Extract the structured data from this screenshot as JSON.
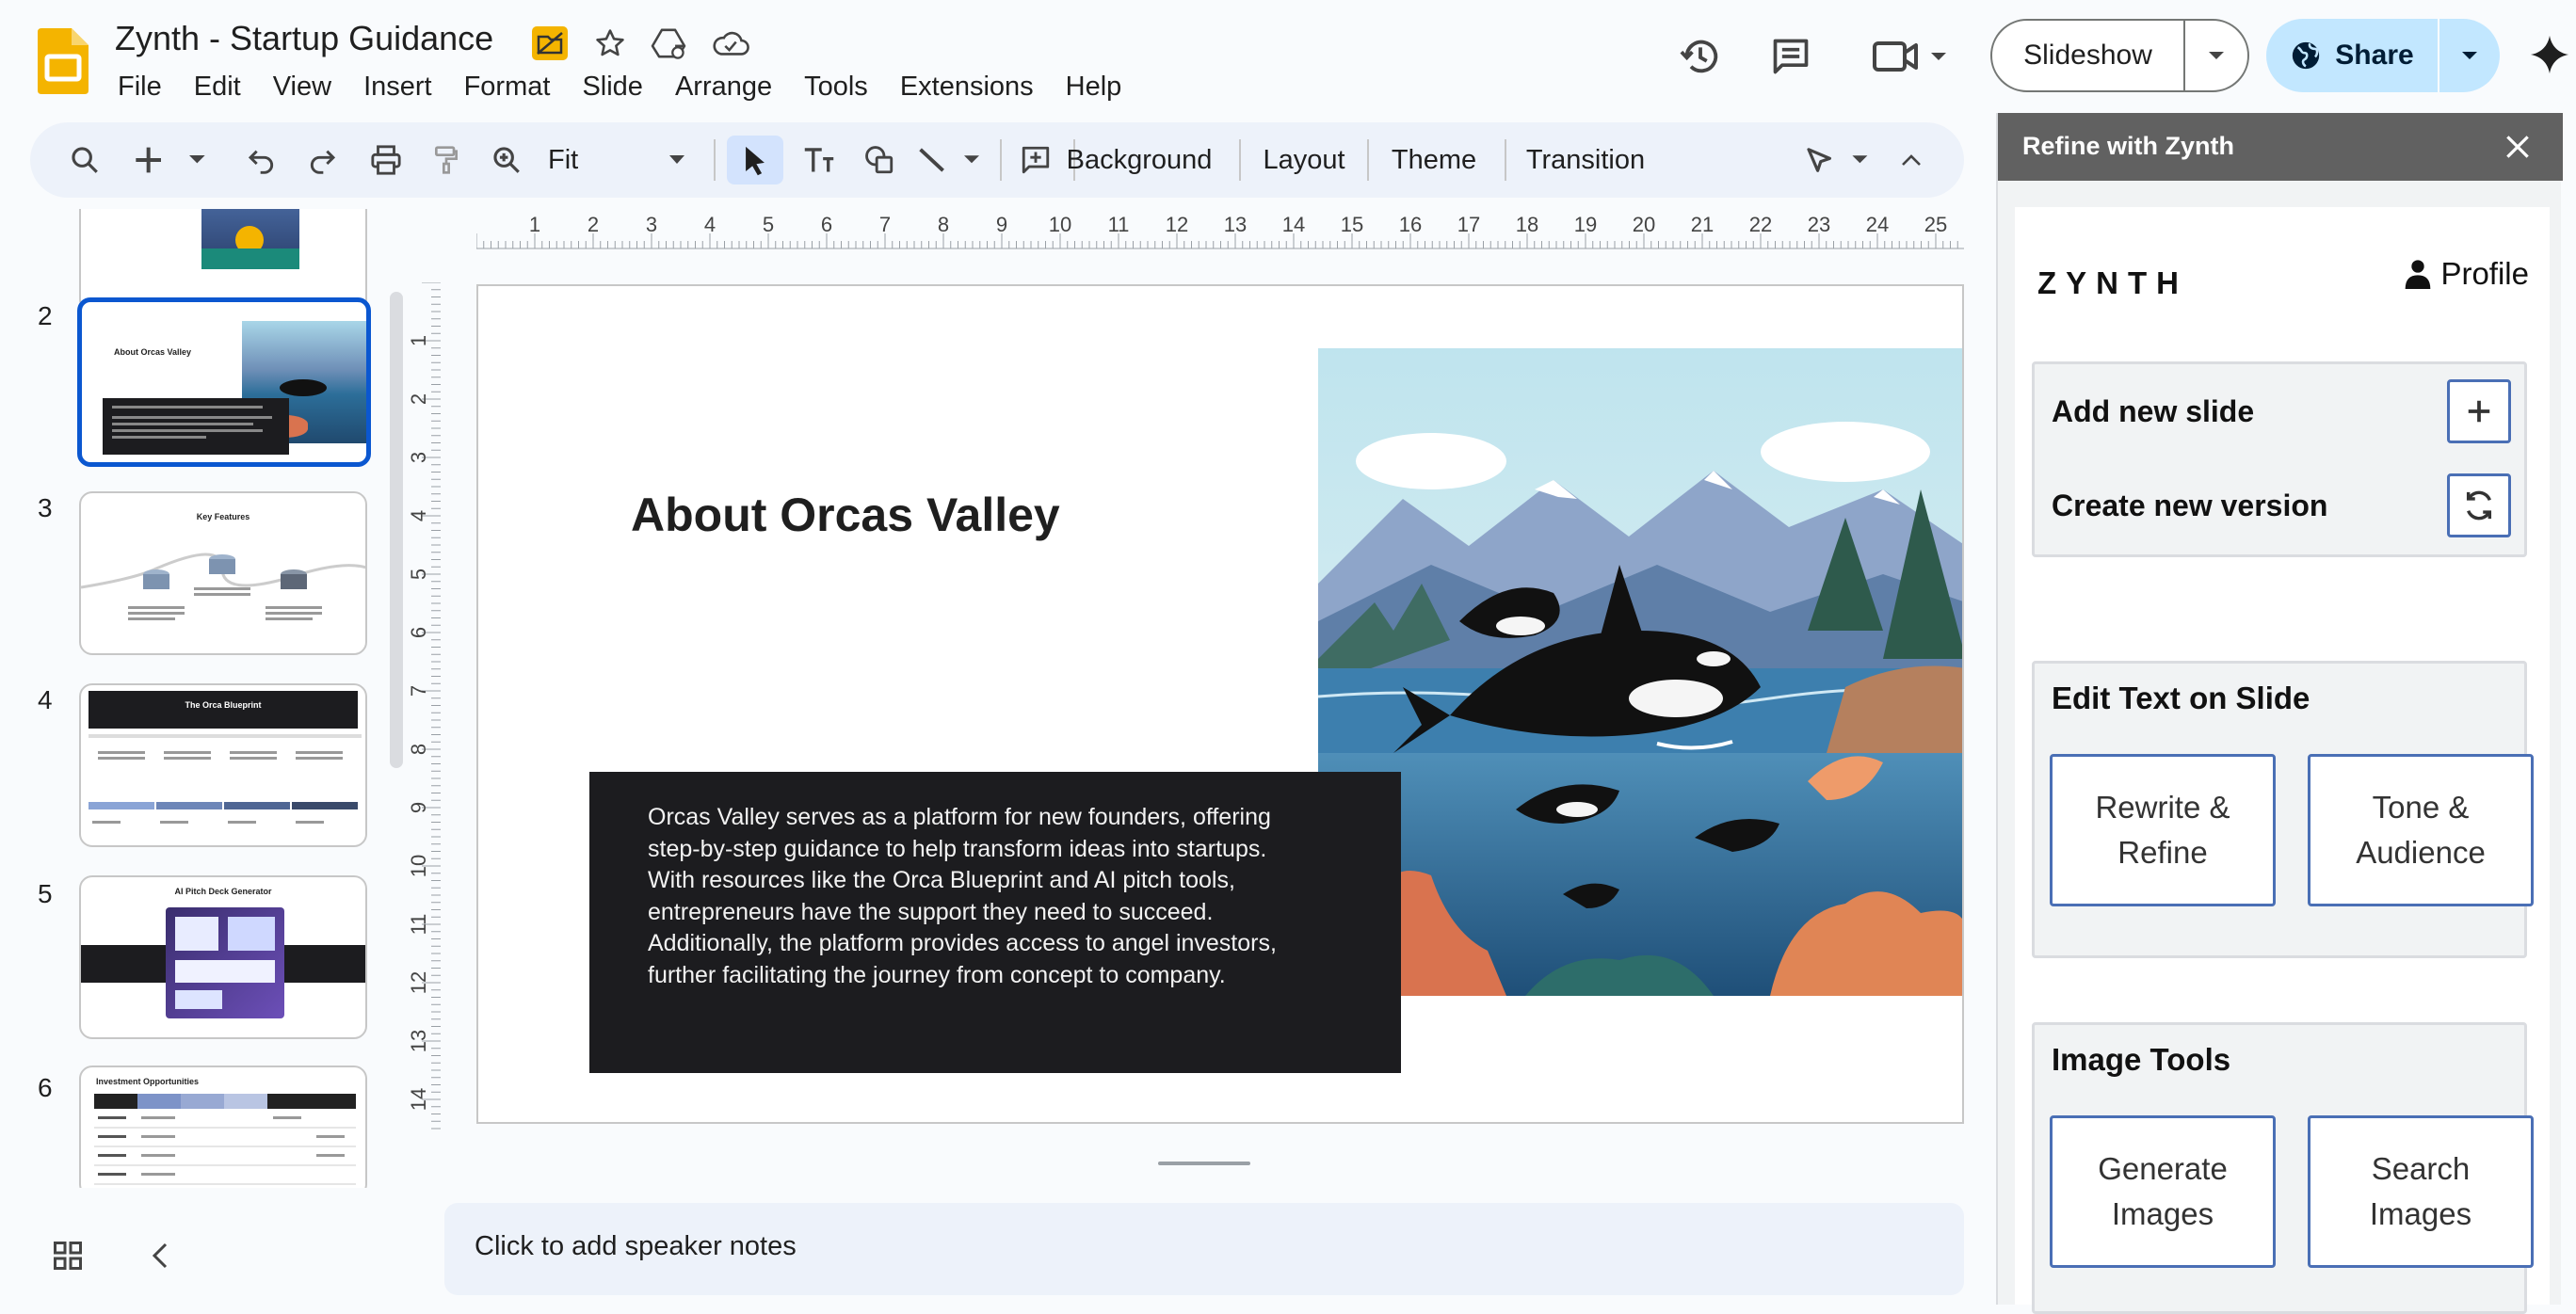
{
  "app": {
    "doc_title": "Zynth - Startup Guidance",
    "menu": [
      "File",
      "Edit",
      "View",
      "Insert",
      "Format",
      "Slide",
      "Arrange",
      "Tools",
      "Extensions",
      "Help"
    ],
    "slideshow_label": "Slideshow",
    "share_label": "Share"
  },
  "toolbar": {
    "zoom_label": "Fit",
    "background_label": "Background",
    "layout_label": "Layout",
    "theme_label": "Theme",
    "transition_label": "Transition"
  },
  "filmstrip": {
    "slides": [
      {
        "number": "2",
        "title": "About Orcas Valley"
      },
      {
        "number": "3",
        "title": "Key Features"
      },
      {
        "number": "4",
        "title": "The Orca Blueprint"
      },
      {
        "number": "5",
        "title": "AI Pitch Deck Generator"
      },
      {
        "number": "6",
        "title": "Investment Opportunities"
      }
    ]
  },
  "ruler": {
    "h_ticks": [
      "1",
      "2",
      "3",
      "4",
      "5",
      "6",
      "7",
      "8",
      "9",
      "10",
      "11",
      "12",
      "13",
      "14",
      "15",
      "16",
      "17",
      "18",
      "19",
      "20",
      "21",
      "22",
      "23",
      "24",
      "25"
    ],
    "v_ticks": [
      "1",
      "2",
      "3",
      "4",
      "5",
      "6",
      "7",
      "8",
      "9",
      "10",
      "11",
      "12",
      "13",
      "14"
    ]
  },
  "slide": {
    "title": "About Orcas Valley",
    "body": "Orcas Valley serves as a platform for new founders, offering step-by-step guidance to help transform ideas into startups. With resources like the Orca Blueprint and AI pitch tools, entrepreneurs have the support they need to succeed. Additionally, the platform provides access to angel investors, further facilitating the journey from concept to company."
  },
  "notes": {
    "placeholder": "Click to add speaker notes"
  },
  "panel": {
    "title": "Refine with Zynth",
    "brand": "ZYNTH",
    "profile_label": "Profile",
    "add_slide_label": "Add new slide",
    "new_version_label": "Create new version",
    "edit_text_title": "Edit Text on Slide",
    "rewrite_label": "Rewrite & Refine",
    "tone_label": "Tone & Audience",
    "image_tools_title": "Image Tools",
    "generate_label": "Generate Images",
    "search_label": "Search Images"
  },
  "colors": {
    "accent_blue": "#0b57d0",
    "share_bg": "#c2e7ff",
    "slides_yellow": "#f4b400",
    "panel_header": "#616161",
    "slide_dark_box": "#1c1c1f"
  },
  "icons": [
    "slides-logo-icon",
    "move-to-folder-icon",
    "star-icon",
    "drive-status-icon",
    "cloud-saved-icon",
    "history-icon",
    "comments-icon",
    "meet-icon",
    "globe-icon",
    "gemini-icon",
    "search-icon",
    "new-slide-icon",
    "undo-icon",
    "redo-icon",
    "print-icon",
    "paint-format-icon",
    "zoom-icon",
    "select-icon",
    "textbox-icon",
    "shapes-icon",
    "line-icon",
    "comment-add-icon",
    "pen-icon",
    "collapse-toolbar-icon",
    "grid-view-icon",
    "chevron-left-icon",
    "close-icon",
    "person-icon",
    "plus-icon",
    "refresh-icon"
  ]
}
